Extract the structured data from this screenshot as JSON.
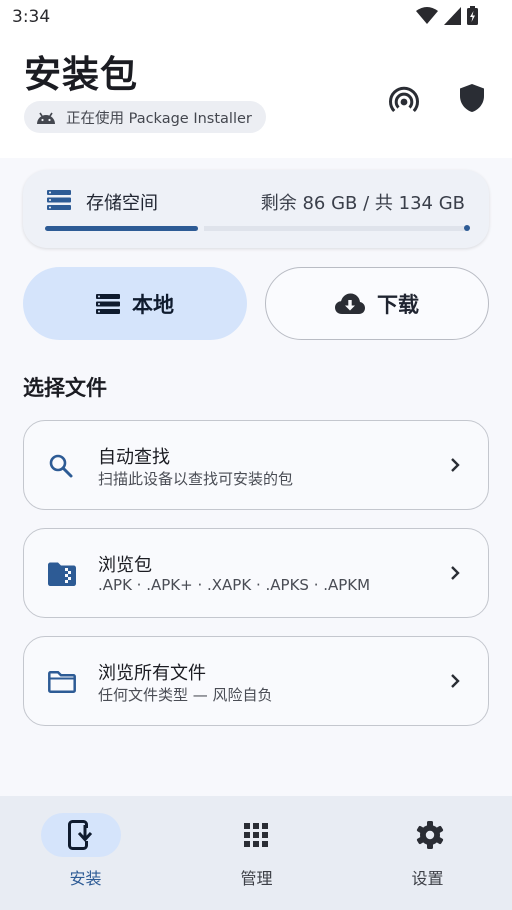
{
  "status_bar": {
    "time": "3:34"
  },
  "header": {
    "title": "安装包",
    "installer_chip": "正在使用 Package Installer"
  },
  "storage": {
    "label": "存储空间",
    "value": "剩余 86 GB / 共 134 GB",
    "used_fraction": 0.36
  },
  "tabs": {
    "local": "本地",
    "download": "下载"
  },
  "section_title": "选择文件",
  "cards": [
    {
      "title": "自动查找",
      "subtitle": "扫描此设备以查找可安装的包",
      "icon": "search-icon"
    },
    {
      "title": "浏览包",
      "subtitle": ".APK · .APK+ · .XAPK · .APKS · .APKM",
      "icon": "package-folder-icon"
    },
    {
      "title": "浏览所有文件",
      "subtitle": "任何文件类型 — 风险自负",
      "icon": "folder-icon"
    }
  ],
  "bottom_nav": [
    {
      "label": "安装",
      "icon": "install-phone-icon",
      "selected": true
    },
    {
      "label": "管理",
      "icon": "grid-icon",
      "selected": false
    },
    {
      "label": "设置",
      "icon": "gear-icon",
      "selected": false
    }
  ],
  "colors": {
    "accent": "#2d5b95",
    "selected_bg": "#d5e4fb",
    "nav_bg": "#e8ecf3"
  }
}
